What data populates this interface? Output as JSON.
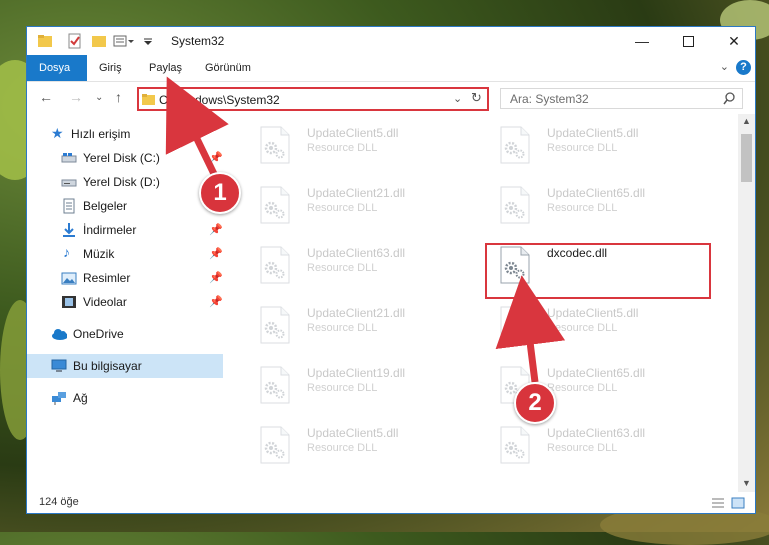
{
  "window": {
    "title": "System32"
  },
  "ribbon": {
    "tabs": [
      "Dosya",
      "Giriş",
      "Paylaş",
      "Görünüm"
    ],
    "help_label": "?"
  },
  "address": {
    "path": "C:\\Windows\\System32"
  },
  "search": {
    "placeholder": "Ara: System32"
  },
  "sidebar": {
    "items": [
      {
        "label": "Hızlı erişim",
        "icon": "star-icon"
      },
      {
        "label": "Yerel Disk (C:)",
        "icon": "drive-icon",
        "pinned": true
      },
      {
        "label": "Yerel Disk (D:)",
        "icon": "drive-icon"
      },
      {
        "label": "Belgeler",
        "icon": "documents-icon",
        "pinned": true
      },
      {
        "label": "İndirmeler",
        "icon": "downloads-icon",
        "pinned": true
      },
      {
        "label": "Müzik",
        "icon": "music-icon",
        "pinned": true
      },
      {
        "label": "Resimler",
        "icon": "pictures-icon",
        "pinned": true
      },
      {
        "label": "Videolar",
        "icon": "videos-icon",
        "pinned": true
      },
      {
        "label": "OneDrive",
        "icon": "cloud-icon"
      },
      {
        "label": "Bu bilgisayar",
        "icon": "computer-icon"
      },
      {
        "label": "Ağ",
        "icon": "network-icon"
      }
    ]
  },
  "files": {
    "left": [
      {
        "name": "UpdateClient5.dll",
        "desc": "Resource DLL"
      },
      {
        "name": "UpdateClient21.dll",
        "desc": "Resource DLL"
      },
      {
        "name": "UpdateClient63.dll",
        "desc": "Resource DLL"
      },
      {
        "name": "UpdateClient21.dll",
        "desc": "Resource DLL"
      },
      {
        "name": "UpdateClient19.dll",
        "desc": "Resource DLL"
      },
      {
        "name": "UpdateClient5.dll",
        "desc": "Resource DLL"
      }
    ],
    "right": [
      {
        "name": "UpdateClient5.dll",
        "desc": "Resource DLL"
      },
      {
        "name": "UpdateClient65.dll",
        "desc": "Resource DLL"
      },
      {
        "name": "dxcodec.dll",
        "desc": ""
      },
      {
        "name": "UpdateClient5.dll",
        "desc": "Resource DLL"
      },
      {
        "name": "UpdateClient65.dll",
        "desc": "Resource DLL"
      },
      {
        "name": "UpdateClient63.dll",
        "desc": "Resource DLL"
      }
    ]
  },
  "status": {
    "count": "124 öğe"
  },
  "annotations": {
    "step1": "1",
    "step2": "2",
    "highlight_color": "#d9363e"
  },
  "colors": {
    "accent": "#1979ca",
    "selected": "#cce4f7"
  }
}
